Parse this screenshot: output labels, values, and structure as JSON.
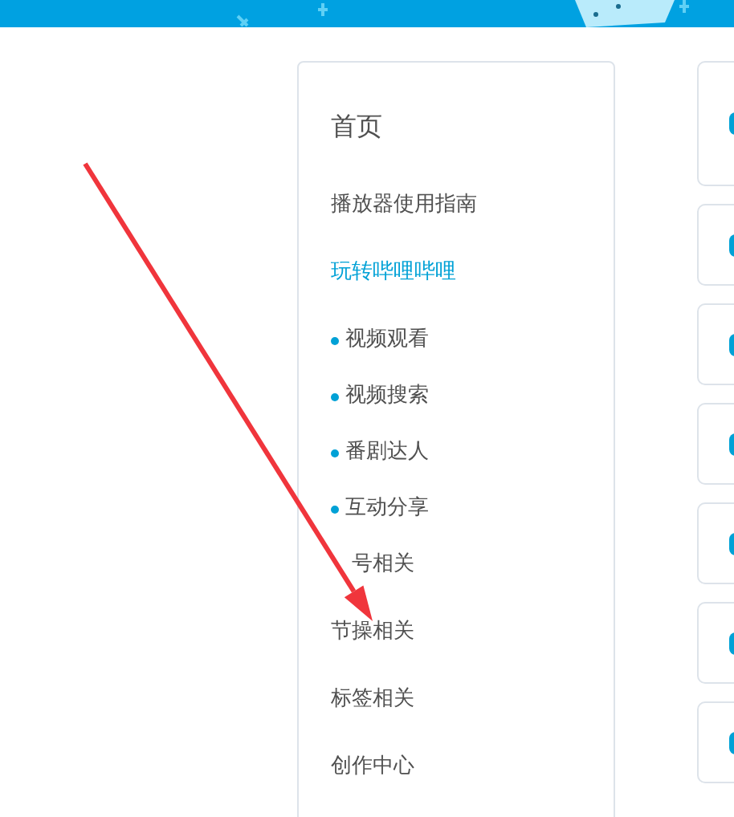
{
  "nav": [
    {
      "label": "首页",
      "kind": "home",
      "selected": false
    },
    {
      "label": "播放器使用指南",
      "kind": "link",
      "selected": false
    },
    {
      "label": "玩转哔哩哔哩",
      "kind": "link",
      "selected": true,
      "children": [
        {
          "label": "视频观看"
        },
        {
          "label": "视频搜索"
        },
        {
          "label": "番剧达人"
        },
        {
          "label": "互动分享"
        }
      ]
    },
    {
      "label": "号相关",
      "kind": "partial",
      "selected": false
    },
    {
      "label": "节操相关",
      "kind": "link",
      "selected": false
    },
    {
      "label": "标签相关",
      "kind": "link",
      "selected": false
    },
    {
      "label": "创作中心",
      "kind": "link",
      "selected": false
    }
  ],
  "side_cards": [
    {
      "kind": "tall"
    },
    {
      "kind": "short"
    },
    {
      "kind": "short"
    },
    {
      "kind": "short"
    },
    {
      "kind": "short"
    },
    {
      "kind": "short"
    },
    {
      "kind": "short"
    }
  ]
}
